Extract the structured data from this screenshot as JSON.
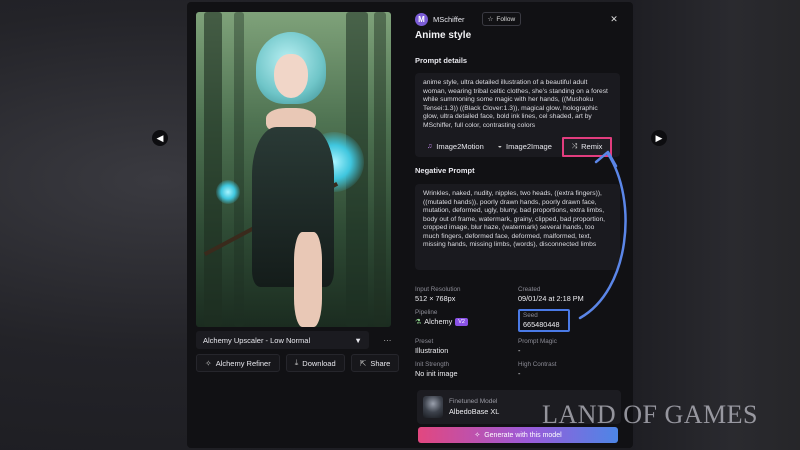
{
  "author": {
    "initial": "M",
    "name": "MSchiffer",
    "follow_label": "Follow"
  },
  "title": "Anime style",
  "prompt": {
    "label": "Prompt details",
    "text": "anime style, ultra detailed illustration of a beautiful adult woman, wearing tribal celtic clothes, she's standing on a forest while summoning some magic with her hands, ((Mushoku Tensei:1.3)) ((Black Clover:1.3)), magical glow, holographic glow, ultra detailed face, bold ink lines, cel shaded, art by MSchiffer, full color, contrasting colors"
  },
  "tools": {
    "image2motion": "Image2Motion",
    "image2image": "Image2Image",
    "remix": "Remix"
  },
  "negative": {
    "label": "Negative Prompt",
    "text": "Wrinkles, naked, nudity, nipples, two heads, ((extra fingers)), ((mutated hands)), poorly drawn hands, poorly drawn face, mutation, deformed, ugly, blurry, bad proportions, extra limbs, body out of frame, watermark, grainy, clipped, bad proportion, cropped image, blur haze, (watermark) several hands, too much fingers, deformed face, deformed, malformed, text, missing hands, missing limbs, (words), disconnected limbs"
  },
  "meta": {
    "input_resolution": {
      "label": "Input Resolution",
      "value": "512 × 768px"
    },
    "created": {
      "label": "Created",
      "value": "09/01/24 at 2:18 PM"
    },
    "pipeline": {
      "label": "Pipeline",
      "value": "Alchemy",
      "badge": "V2"
    },
    "seed": {
      "label": "Seed",
      "value": "665480448"
    },
    "preset": {
      "label": "Preset",
      "value": "Illustration"
    },
    "prompt_magic": {
      "label": "Prompt Magic",
      "value": "-"
    },
    "init_strength": {
      "label": "Init Strength",
      "value": "No init image"
    },
    "high_contrast": {
      "label": "High Contrast",
      "value": "-"
    }
  },
  "model": {
    "label": "Finetuned Model",
    "name": "AlbedoBase XL"
  },
  "generate_label": "Generate with this model",
  "upscaler": {
    "selected": "Alchemy Upscaler - Low Normal"
  },
  "actions": {
    "refiner": "Alchemy Refiner",
    "download": "Download",
    "share": "Share"
  },
  "watermark": "LAND OF GAMES",
  "colors": {
    "remix_highlight": "#e23d7e",
    "seed_highlight": "#4a7ae6",
    "annotation_arrow": "#5b86e8",
    "avatar": "#7b5cd6"
  }
}
